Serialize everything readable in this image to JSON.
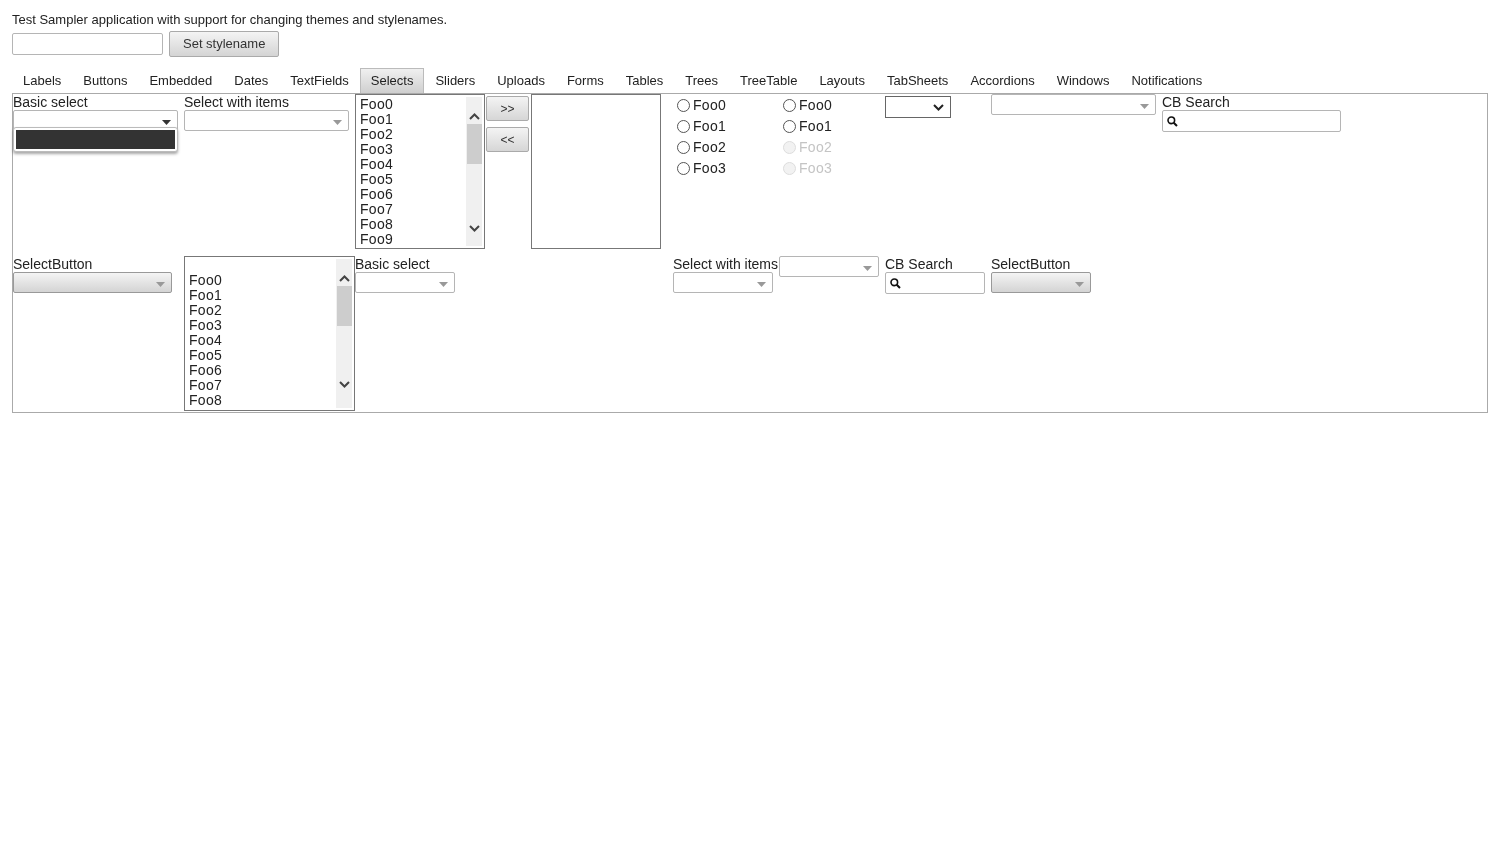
{
  "header": {
    "text": "Test Sampler application with support for changing themes and stylenames.",
    "button": "Set stylename"
  },
  "tabs": [
    {
      "label": "Labels",
      "selected": false
    },
    {
      "label": "Buttons",
      "selected": false
    },
    {
      "label": "Embedded",
      "selected": false
    },
    {
      "label": "Dates",
      "selected": false
    },
    {
      "label": "TextFields",
      "selected": false
    },
    {
      "label": "Selects",
      "selected": true
    },
    {
      "label": "Sliders",
      "selected": false
    },
    {
      "label": "Uploads",
      "selected": false
    },
    {
      "label": "Forms",
      "selected": false
    },
    {
      "label": "Tables",
      "selected": false
    },
    {
      "label": "Trees",
      "selected": false
    },
    {
      "label": "TreeTable",
      "selected": false
    },
    {
      "label": "Layouts",
      "selected": false
    },
    {
      "label": "TabSheets",
      "selected": false
    },
    {
      "label": "Accordions",
      "selected": false
    },
    {
      "label": "Windows",
      "selected": false
    },
    {
      "label": "Notifications",
      "selected": false
    }
  ],
  "panel": {
    "rows": [
      {
        "cells": [
          {
            "kind": "select",
            "label": "Basic select",
            "open": true
          },
          {
            "kind": "select",
            "label": "Select with items",
            "open": false
          },
          {
            "kind": "listbox",
            "items": [
              "Foo0",
              "Foo1",
              "Foo2",
              "Foo3",
              "Foo4",
              "Foo5",
              "Foo6",
              "Foo7",
              "Foo8",
              "Foo9"
            ]
          },
          {
            "kind": "buttons",
            "buttons": [
              ">>",
              "<<"
            ]
          },
          {
            "kind": "emptylist"
          },
          {
            "kind": "radios",
            "options": [
              {
                "label": "Foo0",
                "selected": false,
                "disabled": false
              },
              {
                "label": "Foo1",
                "selected": false,
                "disabled": false
              },
              {
                "label": "Foo2",
                "selected": false,
                "disabled": false
              },
              {
                "label": "Foo3",
                "selected": false,
                "disabled": false
              }
            ]
          },
          {
            "kind": "radios",
            "options": [
              {
                "label": "Foo0",
                "selected": false,
                "disabled": false
              },
              {
                "label": "Foo1",
                "selected": false,
                "disabled": false
              },
              {
                "label": "Foo2",
                "selected": false,
                "disabled": true
              },
              {
                "label": "Foo3",
                "selected": false,
                "disabled": true
              }
            ]
          },
          {
            "kind": "native"
          },
          {
            "kind": "select",
            "open": false
          },
          {
            "kind": "search",
            "label": "CB Search"
          }
        ]
      },
      {
        "cells": [
          {
            "kind": "selectbutton",
            "label": "SelectButton"
          },
          {
            "kind": "listbox",
            "items": [
              "Foo0",
              "Foo1",
              "Foo2",
              "Foo3",
              "Foo4",
              "Foo5",
              "Foo6",
              "Foo7",
              "Foo8"
            ]
          },
          {
            "kind": "select",
            "label": "Basic select",
            "open": false
          },
          "",
          "",
          {
            "kind": "select",
            "label": "Select with items",
            "open": false
          },
          {
            "kind": "select",
            "open": false
          },
          {
            "kind": "search",
            "label": "CB Search"
          },
          {
            "kind": "selectbutton",
            "label": "SelectButton"
          }
        ]
      }
    ]
  }
}
